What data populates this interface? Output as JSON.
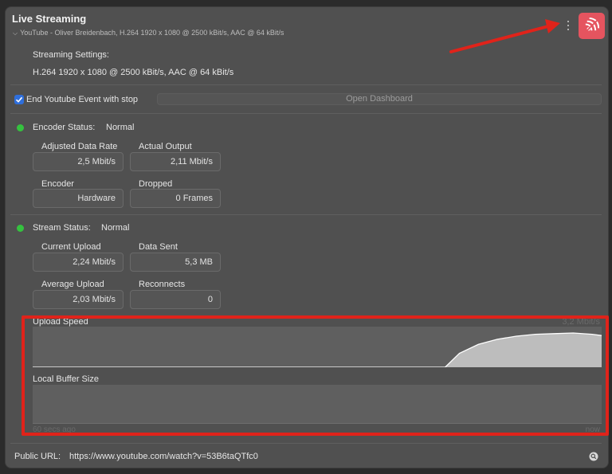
{
  "header": {
    "title": "Live Streaming",
    "subtitle": "YouTube - Oliver Breidenbach, H.264 1920 x 1080 @ 2500 kBit/s, AAC @ 64 kBit/s",
    "subtitle_chevron": "⌵"
  },
  "settings": {
    "label": "Streaming Settings:",
    "value": "H.264 1920 x 1080 @ 2500 kBit/s, AAC @ 64 kBit/s"
  },
  "options": {
    "end_event_label": "End Youtube Event with stop",
    "end_event_checked": true,
    "open_dashboard_label": "Open Dashboard"
  },
  "encoder": {
    "status_label": "Encoder Status:",
    "status_value": "Normal",
    "status_color": "#35c23f",
    "adjusted_rate_label": "Adjusted Data Rate",
    "adjusted_rate_value": "2,5 Mbit/s",
    "actual_output_label": "Actual Output",
    "actual_output_value": "2,11 Mbit/s",
    "encoder_label": "Encoder",
    "encoder_value": "Hardware",
    "dropped_label": "Dropped",
    "dropped_value": "0 Frames"
  },
  "stream": {
    "status_label": "Stream Status:",
    "status_value": "Normal",
    "status_color": "#35c23f",
    "current_upload_label": "Current Upload",
    "current_upload_value": "2,24 Mbit/s",
    "data_sent_label": "Data Sent",
    "data_sent_value": "5,3 MB",
    "average_upload_label": "Average Upload",
    "average_upload_value": "2,03 Mbit/s",
    "reconnects_label": "Reconnects",
    "reconnects_value": "0"
  },
  "graphs": {
    "upload_title": "Upload Speed",
    "upload_max": "3,2 Mbit/s",
    "buffer_title": "Local Buffer Size",
    "x_start": "60 secs ago",
    "x_end": "now",
    "highlight_color": "#e0231a"
  },
  "chart_data": {
    "type": "area",
    "title": "Upload Speed",
    "ylabel": "Mbit/s",
    "ylim": [
      0,
      3.2
    ],
    "xlim": [
      -60,
      0
    ],
    "series": [
      {
        "name": "Upload Speed",
        "x": [
          -60,
          -18,
          -16.5,
          -15,
          -13,
          -11,
          -9,
          -7,
          -5,
          -3,
          -1,
          0
        ],
        "values": [
          0,
          0,
          0,
          1.1,
          1.8,
          2.2,
          2.45,
          2.6,
          2.65,
          2.7,
          2.6,
          2.5
        ]
      }
    ]
  },
  "footer": {
    "url_label": "Public URL:",
    "url_value": "https://www.youtube.com/watch?v=53B6taQTfc0"
  },
  "colors": {
    "accent": "#e5545f",
    "checkbox": "#2f6fdc",
    "annotation": "#e0231a"
  },
  "icons": {
    "menu": "more-vertical-icon",
    "broadcast": "broadcast-icon",
    "check": "checkmark-icon",
    "link": "link-icon"
  }
}
